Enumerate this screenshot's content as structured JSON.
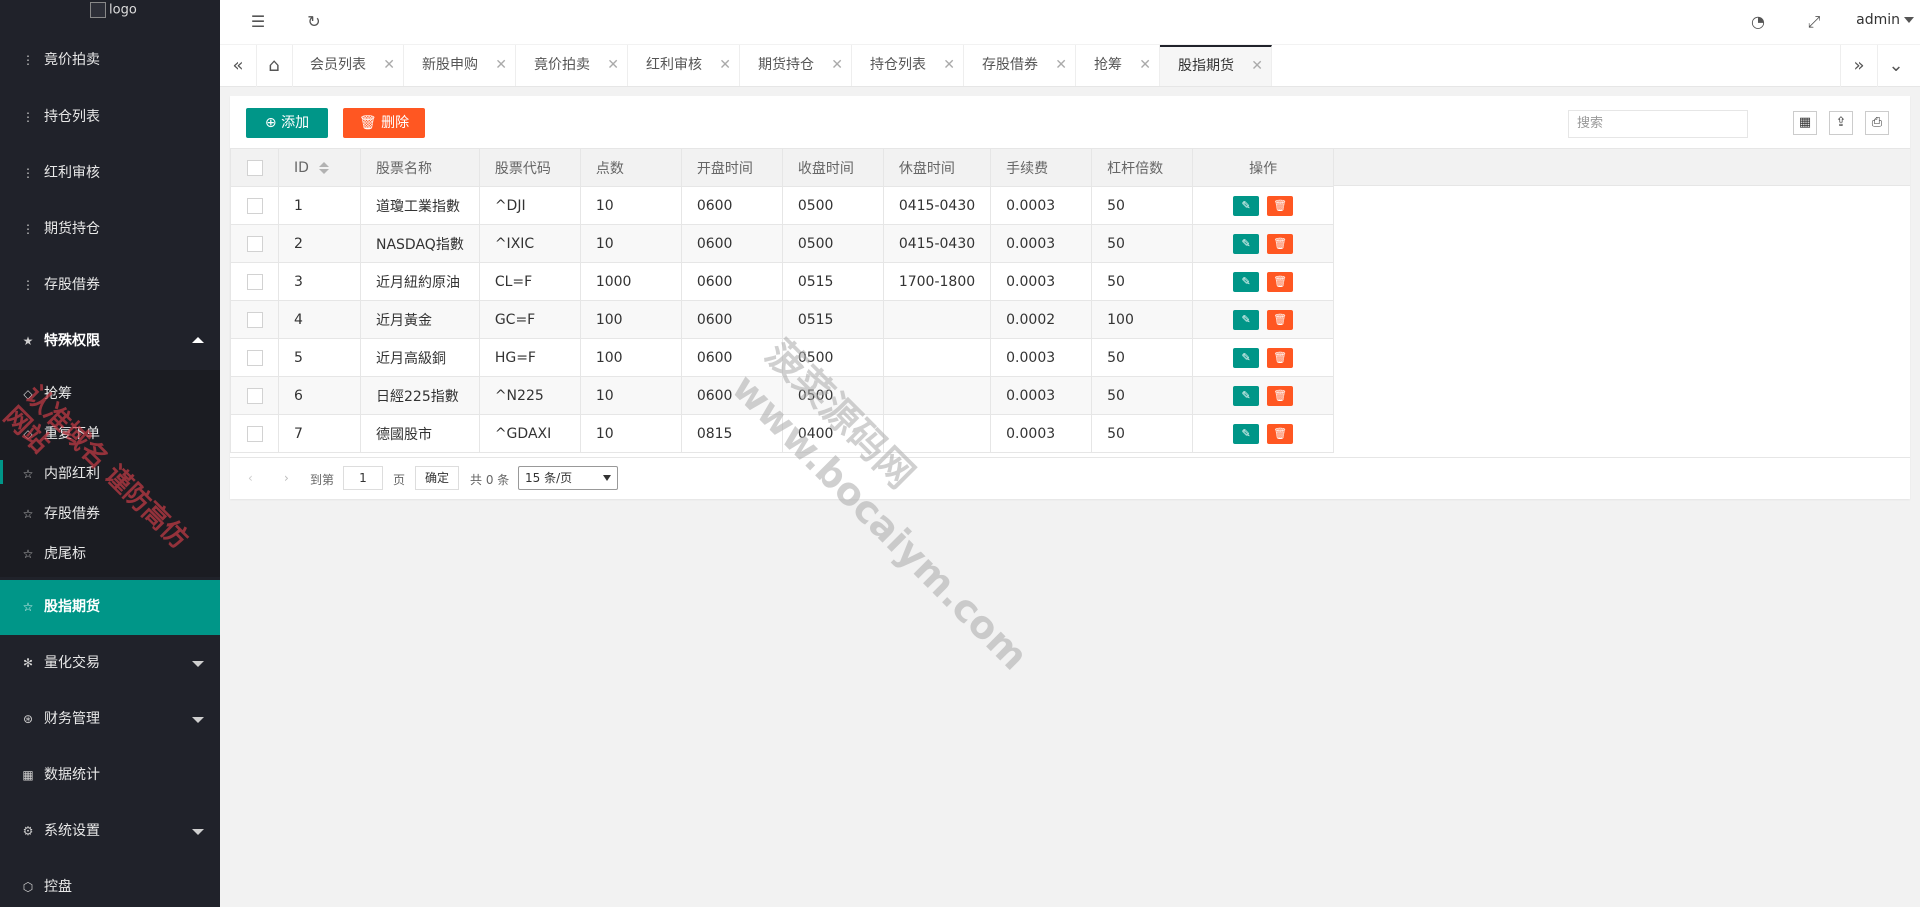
{
  "sidebar": {
    "logo_alt": "logo",
    "items_top": [
      "竟价拍卖",
      "持仓列表",
      "红利审核",
      "期货持仓",
      "存股借券"
    ],
    "group_special": "特殊权限",
    "children": [
      "抢筹",
      "重复下单",
      "内部红利",
      "存股借券",
      "虎尾标"
    ],
    "active": "股指期货",
    "groups_bottom": [
      "量化交易",
      "财务管理",
      "数据统计",
      "系统设置",
      "控盘"
    ]
  },
  "header": {
    "user": "admin"
  },
  "tabs": [
    "会员列表",
    "新股申购",
    "竟价拍卖",
    "红利审核",
    "期货持仓",
    "持仓列表",
    "存股借券",
    "抢筹",
    "股指期货"
  ],
  "toolbar": {
    "add_label": "添加",
    "delete_label": "删除",
    "search_placeholder": "搜索"
  },
  "table": {
    "columns": [
      "ID",
      "股票名称",
      "股票代码",
      "点数",
      "开盘时间",
      "收盘时间",
      "休盘时间",
      "手续费",
      "杠杆倍数",
      "操作"
    ],
    "rows": [
      [
        "1",
        "道瓊工業指數",
        "^DJI",
        "10",
        "0600",
        "0500",
        "0415-0430",
        "0.0003",
        "50"
      ],
      [
        "2",
        "NASDAQ指數",
        "^IXIC",
        "10",
        "0600",
        "0500",
        "0415-0430",
        "0.0003",
        "50"
      ],
      [
        "3",
        "近月紐約原油",
        "CL=F",
        "1000",
        "0600",
        "0515",
        "1700-1800",
        "0.0003",
        "50"
      ],
      [
        "4",
        "近月黃金",
        "GC=F",
        "100",
        "0600",
        "0515",
        "",
        "0.0002",
        "100"
      ],
      [
        "5",
        "近月高級銅",
        "HG=F",
        "100",
        "0600",
        "0500",
        "",
        "0.0003",
        "50"
      ],
      [
        "6",
        "日經225指數",
        "^N225",
        "10",
        "0600",
        "0500",
        "",
        "0.0003",
        "50"
      ],
      [
        "7",
        "德國股市",
        "^GDAXI",
        "10",
        "0815",
        "0400",
        "",
        "0.0003",
        "50"
      ]
    ]
  },
  "pager": {
    "goto_label": "到第",
    "page_value": "1",
    "page_unit": "页",
    "confirm": "确定",
    "total": "共 0 条",
    "page_size": "15 条/页"
  },
  "watermarks": {
    "left": "认准域名 谨防高仿网站",
    "center_line1": "菠菜源码网",
    "center_line2": "www.bocaiym.com"
  }
}
